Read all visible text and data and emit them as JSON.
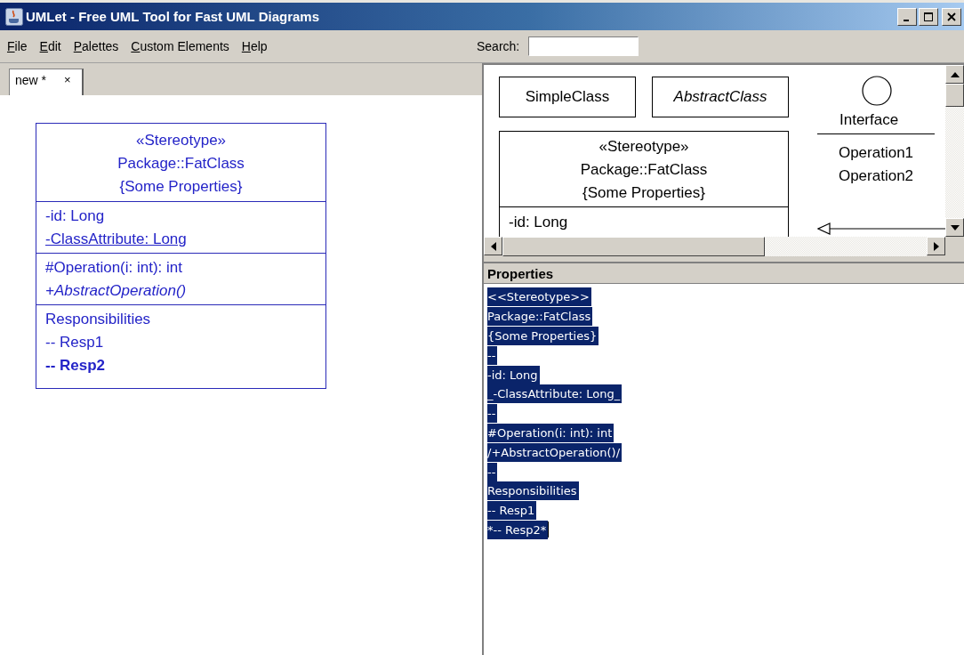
{
  "window": {
    "title": "UMLet - Free UML Tool for Fast UML Diagrams"
  },
  "menu": [
    "File",
    "Edit",
    "Palettes",
    "Custom Elements",
    "Help"
  ],
  "search": {
    "label": "Search:"
  },
  "tabs": [
    {
      "label": "new *",
      "close": "×",
      "selected": true
    }
  ],
  "diagram": {
    "compartments": [
      [
        {
          "text": "«Stereotype»",
          "kind": "heading"
        },
        {
          "text": "Package::FatClass",
          "kind": "heading"
        },
        {
          "text": "{Some Properties}",
          "kind": "heading"
        }
      ],
      [
        {
          "text": "-id: Long",
          "kind": "plain"
        },
        {
          "text": "-ClassAttribute: Long",
          "kind": "static"
        }
      ],
      [
        {
          "text": "#Operation(i: int): int",
          "kind": "plain"
        },
        {
          "text": "+AbstractOperation()",
          "kind": "abstract"
        }
      ],
      [
        {
          "text": "Responsibilities",
          "kind": "plain"
        },
        {
          "text": "-- Resp1",
          "kind": "plain"
        },
        {
          "text": "-- Resp2",
          "kind": "strong"
        }
      ]
    ]
  },
  "palette": {
    "simple_class": "SimpleClass",
    "abstract_class": "AbstractClass",
    "interface": {
      "name": "Interface",
      "operations": [
        "Operation1",
        "Operation2"
      ]
    },
    "fat_class": {
      "header": [
        "«Stereotype»",
        "Package::FatClass",
        "{Some Properties}"
      ],
      "attributes": [
        "-id: Long"
      ]
    }
  },
  "properties": {
    "title": "Properties",
    "selected": true,
    "lines": [
      "<<Stereotype>>",
      "Package::FatClass",
      "{Some Properties}",
      "--",
      "-id: Long",
      "_-ClassAttribute: Long_",
      "--",
      "#Operation(i: int): int",
      "/+AbstractOperation()/",
      "--",
      "Responsibilities",
      "-- Resp1",
      "*-- Resp2*"
    ]
  }
}
